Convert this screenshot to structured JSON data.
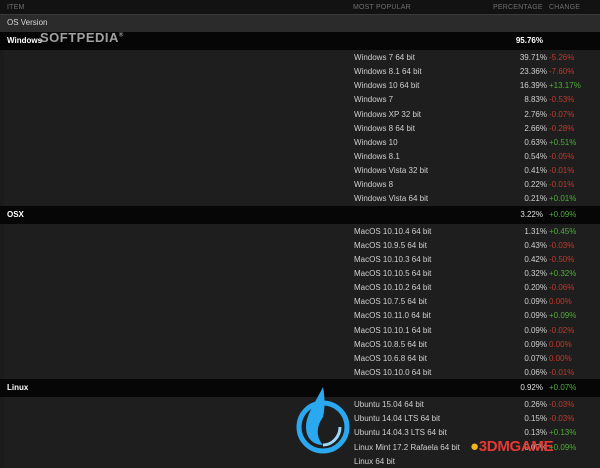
{
  "header": {
    "item": "ITEM",
    "most_popular": "MOST POPULAR",
    "percentage": "PERCENTAGE",
    "change": "CHANGE"
  },
  "section_title": "OS Version",
  "groups": [
    {
      "name": "Windows",
      "percentage": "95.76%",
      "change": "",
      "rows": [
        {
          "name": "Windows 7 64 bit",
          "percentage": "39.71%",
          "change": "-5.26%",
          "trend": "neg"
        },
        {
          "name": "Windows 8.1 64 bit",
          "percentage": "23.36%",
          "change": "-7.60%",
          "trend": "neg"
        },
        {
          "name": "Windows 10 64 bit",
          "percentage": "16.39%",
          "change": "+13.17%",
          "trend": "pos"
        },
        {
          "name": "Windows 7",
          "percentage": "8.83%",
          "change": "-0.53%",
          "trend": "neg"
        },
        {
          "name": "Windows XP 32 bit",
          "percentage": "2.76%",
          "change": "-0.07%",
          "trend": "neg"
        },
        {
          "name": "Windows 8 64 bit",
          "percentage": "2.66%",
          "change": "-0.28%",
          "trend": "neg"
        },
        {
          "name": "Windows 10",
          "percentage": "0.63%",
          "change": "+0.51%",
          "trend": "pos"
        },
        {
          "name": "Windows 8.1",
          "percentage": "0.54%",
          "change": "-0.05%",
          "trend": "neg"
        },
        {
          "name": "Windows Vista 32 bit",
          "percentage": "0.41%",
          "change": "-0.01%",
          "trend": "neg"
        },
        {
          "name": "Windows 8",
          "percentage": "0.22%",
          "change": "-0.01%",
          "trend": "neg"
        },
        {
          "name": "Windows Vista 64 bit",
          "percentage": "0.21%",
          "change": "+0.01%",
          "trend": "pos"
        }
      ]
    },
    {
      "name": "OSX",
      "percentage": "3.22%",
      "change": "+0.09%",
      "change_trend": "pos",
      "rows": [
        {
          "name": "MacOS 10.10.4 64 bit",
          "percentage": "1.31%",
          "change": "+0.45%",
          "trend": "pos"
        },
        {
          "name": "MacOS 10.9.5 64 bit",
          "percentage": "0.43%",
          "change": "-0.03%",
          "trend": "neg"
        },
        {
          "name": "MacOS 10.10.3 64 bit",
          "percentage": "0.42%",
          "change": "-0.50%",
          "trend": "neg"
        },
        {
          "name": "MacOS 10.10.5 64 bit",
          "percentage": "0.32%",
          "change": "+0.32%",
          "trend": "pos"
        },
        {
          "name": "MacOS 10.10.2 64 bit",
          "percentage": "0.20%",
          "change": "-0.06%",
          "trend": "neg"
        },
        {
          "name": "MacOS 10.7.5 64 bit",
          "percentage": "0.09%",
          "change": "0.00%",
          "trend": "zero"
        },
        {
          "name": "MacOS 10.11.0 64 bit",
          "percentage": "0.09%",
          "change": "+0.09%",
          "trend": "pos"
        },
        {
          "name": "MacOS 10.10.1 64 bit",
          "percentage": "0.09%",
          "change": "-0.02%",
          "trend": "neg"
        },
        {
          "name": "MacOS 10.8.5 64 bit",
          "percentage": "0.09%",
          "change": "0.00%",
          "trend": "zero"
        },
        {
          "name": "MacOS 10.6.8 64 bit",
          "percentage": "0.07%",
          "change": "0.00%",
          "trend": "zero"
        },
        {
          "name": "MacOS 10.10.0 64 bit",
          "percentage": "0.06%",
          "change": "-0.01%",
          "trend": "neg"
        }
      ]
    },
    {
      "name": "Linux",
      "percentage": "0.92%",
      "change": "+0.07%",
      "change_trend": "pos",
      "rows": [
        {
          "name": "Ubuntu 15.04 64 bit",
          "percentage": "0.26%",
          "change": "-0.03%",
          "trend": "neg"
        },
        {
          "name": "Ubuntu 14.04 LTS 64 bit",
          "percentage": "0.15%",
          "change": "-0.03%",
          "trend": "neg"
        },
        {
          "name": "Ubuntu 14.04.3 LTS 64 bit",
          "percentage": "0.13%",
          "change": "+0.13%",
          "trend": "pos"
        },
        {
          "name": "Linux Mint 17.2 Rafaela 64 bit",
          "percentage": "0.09%",
          "change": "+0.09%",
          "trend": "pos"
        },
        {
          "name": "Linux 64 bit",
          "percentage": "",
          "change": "",
          "trend": "pos"
        }
      ]
    }
  ],
  "watermarks": {
    "softpedia": "SOFTPEDIA",
    "game_site": "3DMGAME"
  },
  "colors": {
    "negative": "#c0392b",
    "positive": "#4caf32",
    "background": "#1b1b1b"
  }
}
